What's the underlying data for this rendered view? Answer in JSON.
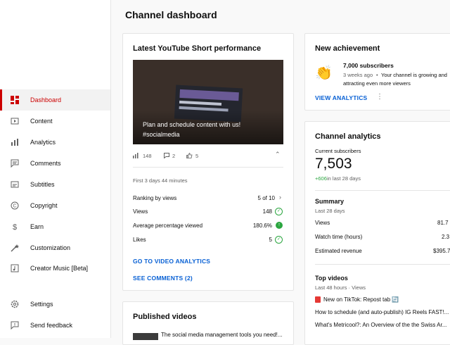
{
  "page_title": "Channel dashboard",
  "sidebar": {
    "items": [
      {
        "label": "Dashboard",
        "icon": "dashboard-icon",
        "active": true
      },
      {
        "label": "Content",
        "icon": "content-icon"
      },
      {
        "label": "Analytics",
        "icon": "analytics-icon"
      },
      {
        "label": "Comments",
        "icon": "comments-icon"
      },
      {
        "label": "Subtitles",
        "icon": "subtitles-icon"
      },
      {
        "label": "Copyright",
        "icon": "copyright-icon"
      },
      {
        "label": "Earn",
        "icon": "earn-icon"
      },
      {
        "label": "Customization",
        "icon": "customization-icon"
      },
      {
        "label": "Creator Music [Beta]",
        "icon": "creator-music-icon"
      },
      {
        "label": "Settings",
        "icon": "settings-icon"
      },
      {
        "label": "Send feedback",
        "icon": "feedback-icon"
      }
    ]
  },
  "short_card": {
    "title": "Latest YouTube Short performance",
    "thumb_caption": "Plan and schedule content with us! #socialmedia",
    "views": "148",
    "comments": "2",
    "likes": "5",
    "period": "First 3 days 44 minutes",
    "rows": [
      {
        "label": "Ranking by views",
        "value": "5 of 10"
      },
      {
        "label": "Views",
        "value": "148"
      },
      {
        "label": "Average percentage viewed",
        "value": "180.6%"
      },
      {
        "label": "Likes",
        "value": "5"
      }
    ],
    "link_analytics": "GO TO VIDEO ANALYTICS",
    "link_comments": "SEE COMMENTS (2)"
  },
  "published_card": {
    "title": "Published videos",
    "first_video": "The social media management tools you need!..."
  },
  "achievement_card": {
    "title": "New achievement",
    "emoji": "👏",
    "milestone": "7,000 subscribers",
    "time": "3 weeks ago",
    "desc_1": "Your channel is growing and",
    "desc_2": "attracting even more viewers",
    "link": "VIEW ANALYTICS"
  },
  "analytics_card": {
    "title": "Channel analytics",
    "current_label": "Current subscribers",
    "subscribers": "7,503",
    "delta": "+606",
    "delta_period": "in last 28 days",
    "summary_title": "Summary",
    "summary_period": "Last 28 days",
    "summary_rows": [
      {
        "label": "Views",
        "value": "81.7"
      },
      {
        "label": "Watch time (hours)",
        "value": "2.3"
      },
      {
        "label": "Estimated revenue",
        "value": "$395.7"
      }
    ],
    "top_title": "Top videos",
    "top_period": "Last 48 hours · Views",
    "top_videos": [
      "New on TikTok: Repost tab 🔄",
      "How to schedule (and auto-publish) IG Reels FAST!...",
      "What's Metricool?: An Overview of the the Swiss Ar..."
    ]
  },
  "colors": {
    "accent": "#cc0000",
    "link": "#065fd4",
    "positive": "#2ba640"
  }
}
